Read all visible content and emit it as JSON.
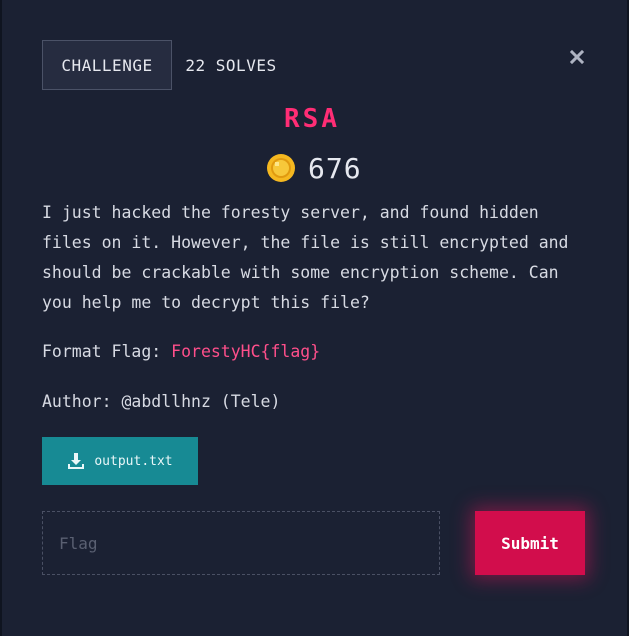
{
  "tabs": {
    "challenge_label": "CHALLENGE",
    "solves_label": "22 SOLVES"
  },
  "close_icon": "close-icon",
  "challenge": {
    "title": "RSA",
    "points": "676",
    "description": "I just hacked the foresty server, and found hidden files on it. However, the file is still encrypted and should be crackable with some encryption scheme. Can you help me to decrypt this file?",
    "format_label": "Format Flag: ",
    "format_value": "ForestyHC{flag}",
    "author_line": "Author: @abdllhnz (Tele)"
  },
  "download": {
    "icon": "download-icon",
    "filename": "output.txt"
  },
  "flag_form": {
    "placeholder": "Flag",
    "submit_label": "Submit"
  },
  "colors": {
    "background": "#1b2133",
    "accent_pink": "#ff2d75",
    "download_teal": "#178a94",
    "submit_red": "#d20d4c",
    "coin_gold": "#f5b820"
  }
}
